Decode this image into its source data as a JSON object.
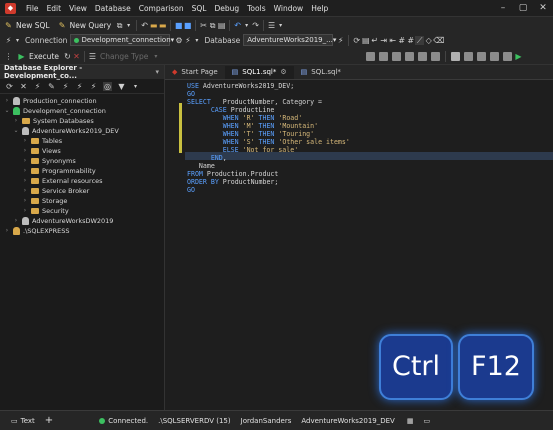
{
  "menu": [
    "File",
    "Edit",
    "View",
    "Database",
    "Comparison",
    "SQL",
    "Debug",
    "Tools",
    "Window",
    "Help"
  ],
  "toolbar1": {
    "new_sql": "New SQL",
    "new_query": "New Query"
  },
  "toolbar2": {
    "connection_label": "Connection",
    "connection_value": "Development_connection",
    "database_label": "Database",
    "database_value": "AdventureWorks2019_..."
  },
  "toolbar3": {
    "execute": "Execute",
    "change_type": "Change Type"
  },
  "explorer": {
    "title": "Database Explorer - Development_co...",
    "nodes": [
      {
        "label": "Production_connection"
      },
      {
        "label": "Development_connection"
      },
      {
        "label": "System Databases"
      },
      {
        "label": "AdventureWorks2019_DEV"
      },
      {
        "label": "Tables"
      },
      {
        "label": "Views"
      },
      {
        "label": "Synonyms"
      },
      {
        "label": "Programmability"
      },
      {
        "label": "External resources"
      },
      {
        "label": "Service Broker"
      },
      {
        "label": "Storage"
      },
      {
        "label": "Security"
      },
      {
        "label": "AdventureWorksDW2019"
      },
      {
        "label": ".\\SQLEXPRESS"
      }
    ]
  },
  "tabs": [
    {
      "label": "Start Page"
    },
    {
      "label": "SQL1.sql*"
    },
    {
      "label": "SQL.sql*"
    }
  ],
  "editor_lines": [
    "USE AdventureWorks2019_DEV;",
    "GO",
    "SELECT   ProductNumber, Category =",
    "      CASE ProductLine",
    "         WHEN 'R' THEN 'Road'",
    "         WHEN 'M' THEN 'Mountain'",
    "         WHEN 'T' THEN 'Touring'",
    "         WHEN 'S' THEN 'Other sale items'",
    "         ELSE 'Not for sale'",
    "      END,",
    "   Name",
    "FROM Production.Product",
    "ORDER BY ProductNumber;",
    "GO"
  ],
  "status": {
    "mode": "Text",
    "connected": "Connected.",
    "server": ".\\SQLSERVERDV (15)",
    "user": "JordanSanders",
    "database": "AdventureWorks2019_DEV"
  },
  "keys": {
    "key1": "Ctrl",
    "key2": "F12"
  },
  "colors": {
    "accent": "#3f7fd8",
    "key_fill": "#1b3a8e",
    "change_marker": "#c9c040"
  }
}
